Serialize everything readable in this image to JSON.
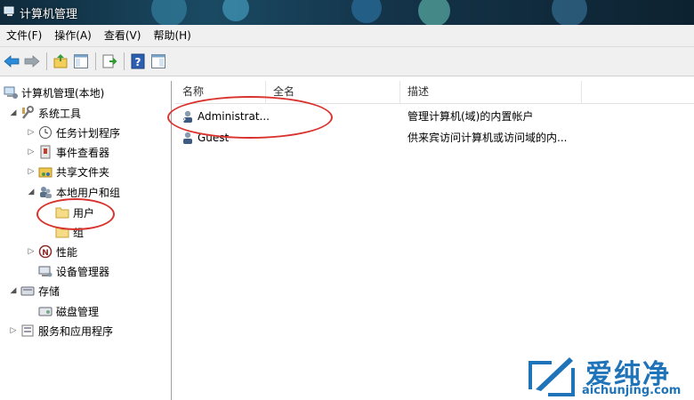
{
  "window": {
    "title": "计算机管理"
  },
  "menu": [
    "文件(F)",
    "操作(A)",
    "查看(V)",
    "帮助(H)"
  ],
  "toolbar": {
    "buttons": [
      "back-icon",
      "forward-icon",
      "up-folder-icon",
      "show-hide-tree-icon",
      "export-list-icon",
      "help-icon",
      "show-action-pane-icon"
    ]
  },
  "tree": {
    "root": "计算机管理(本地)",
    "system_tools": "系统工具",
    "task_scheduler": "任务计划程序",
    "event_viewer": "事件查看器",
    "shared_folders": "共享文件夹",
    "local_users_groups": "本地用户和组",
    "users": "用户",
    "groups": "组",
    "performance": "性能",
    "device_manager": "设备管理器",
    "storage": "存储",
    "disk_management": "磁盘管理",
    "services_apps": "服务和应用程序"
  },
  "list": {
    "columns": [
      "名称",
      "全名",
      "描述"
    ],
    "rows": [
      {
        "name": "Administrat...",
        "fullname": "",
        "description": "管理计算机(域)的内置帐户"
      },
      {
        "name": "Guest",
        "fullname": "",
        "description": "供来宾访问计算机或访问域的内..."
      }
    ]
  },
  "watermark": {
    "title": "爱纯净",
    "url": "aichunjing.com"
  },
  "colors": {
    "annotation": "#d9332e",
    "watermark": "#1f73b8"
  }
}
